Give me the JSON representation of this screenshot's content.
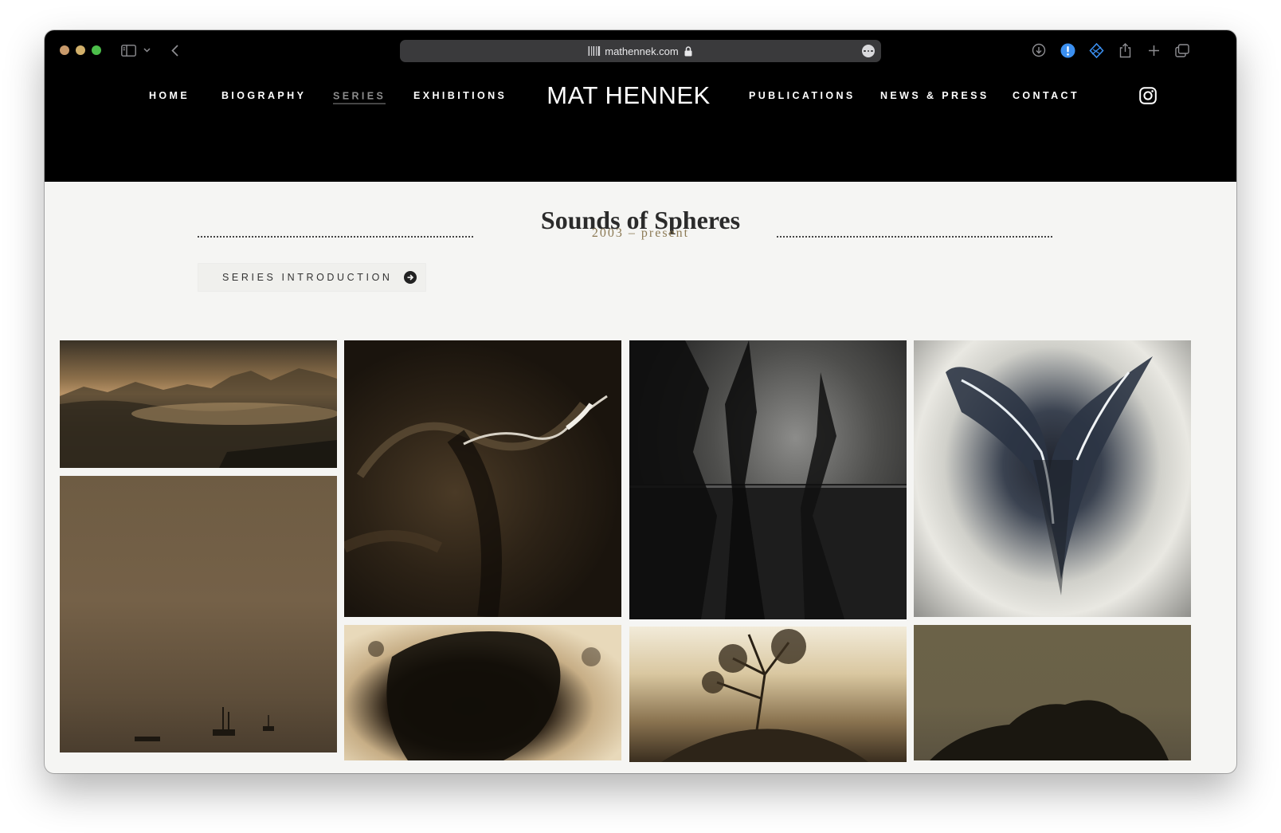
{
  "browser": {
    "url": "mathennek.com",
    "tab_icons": [
      "sidebar-icon",
      "chevron-down-icon",
      "back-icon"
    ],
    "right_icons": [
      "download-icon",
      "alert-icon",
      "vpn-icon",
      "share-icon",
      "new-tab-icon",
      "tabs-overview-icon"
    ]
  },
  "site": {
    "logo": "MAT HENNEK",
    "nav_left": [
      "HOME",
      "BIOGRAPHY",
      "SERIES",
      "EXHIBITIONS"
    ],
    "nav_right": [
      "PUBLICATIONS",
      "NEWS & PRESS",
      "CONTACT"
    ],
    "active_nav": "SERIES"
  },
  "series": {
    "title": "Sounds of Spheres",
    "years": "2003 – present",
    "intro_button": "SERIES INTRODUCTION"
  },
  "gallery": {
    "photos": [
      "misty-lake-landscape",
      "foggy-water-boats",
      "aerial-brown-terrain",
      "dark-sea-trees",
      "aerial-ice-blue",
      "dark-stone-crust",
      "sepia-tree-rock",
      "olive-tree-silhouette"
    ]
  },
  "colors": {
    "header_bg": "#000000",
    "page_bg": "#f5f5f3",
    "accent_gold": "#8c7a55"
  }
}
